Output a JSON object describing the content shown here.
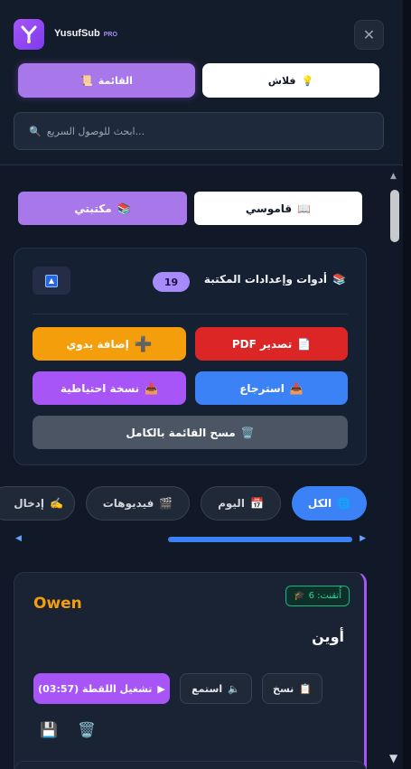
{
  "header": {
    "brand": "YusufSub",
    "brand_tag": "PRO",
    "close_glyph": "✕",
    "tabs": [
      {
        "label": "القائمة",
        "icon": "📜"
      },
      {
        "label": "فلاش",
        "icon": "💡"
      }
    ],
    "search_placeholder": "ابحث للوصول السريع..."
  },
  "library_tabs": [
    {
      "label": "مكتبتي",
      "icon": "📚"
    },
    {
      "label": "قاموسي",
      "icon": "📖"
    }
  ],
  "tools": {
    "title": "أدوات وإعدادات المكتبة",
    "title_icon": "📚",
    "count": "19",
    "buttons": {
      "add_manual": "إضافة يدوي",
      "export_pdf": "PDF تصدير",
      "backup": "نسخة احتياطية",
      "restore": "استرجاع",
      "clear_all": "مسح القائمة بالكامل"
    }
  },
  "filters": [
    {
      "label": "الكل",
      "icon": "🌐"
    },
    {
      "label": "اليوم",
      "icon": "📅"
    },
    {
      "label": "فيديوهات",
      "icon": "🎬"
    },
    {
      "label": "إدخال",
      "icon": "✍️"
    }
  ],
  "card": {
    "word": "Owen",
    "mastered": "أُتقنت: 6",
    "mastered_icon": "🎓",
    "translation": "أوين",
    "copy_label": "نسخ",
    "listen_label": "استمع",
    "play_label": "تشغيل اللقطة (03:57)"
  },
  "colors": {
    "accent_purple": "#a855f7",
    "accent_blue": "#3b82f6",
    "word_orange": "#f59e0b",
    "mastered_green": "#10b981"
  }
}
